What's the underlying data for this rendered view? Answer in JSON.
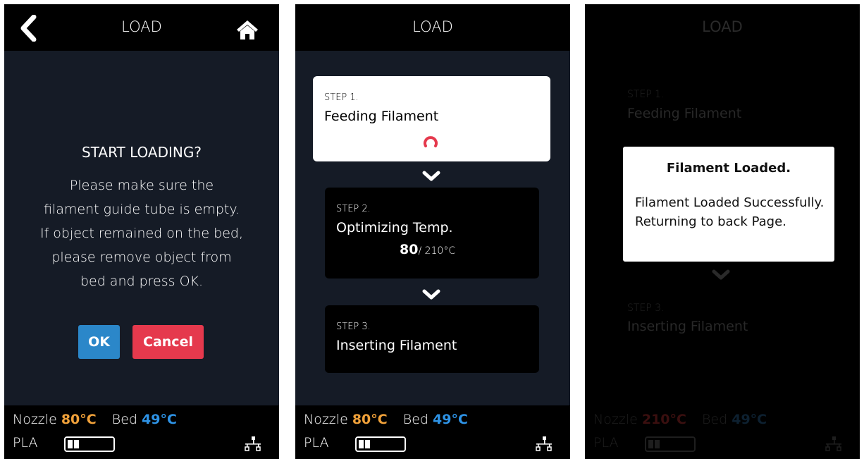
{
  "screens": [
    {
      "title": "LOAD",
      "prompt_title": "START LOADING?",
      "prompt_lines": [
        "Please make sure the",
        "filament guide tube is empty.",
        "If object remained on the bed,",
        "please remove object from",
        "bed and press OK."
      ],
      "ok_label": "OK",
      "cancel_label": "Cancel"
    },
    {
      "title": "LOAD",
      "steps": [
        {
          "kicker": "STEP 1.",
          "name": "Feeding Filament"
        },
        {
          "kicker": "STEP 2.",
          "name": "Optimizing Temp.",
          "current": "80",
          "target": "/ 210°C"
        },
        {
          "kicker": "STEP 3.",
          "name": "Inserting Filament"
        }
      ]
    },
    {
      "title": "LOAD",
      "steps": [
        {
          "kicker": "STEP 1.",
          "name": "Feeding Filament"
        },
        {
          "kicker": "STEP 3.",
          "name": "Inserting Filament"
        }
      ],
      "modal_title": "Filament Loaded.",
      "modal_body": "Filament Loaded Successfully. Returning to back Page."
    }
  ],
  "status": [
    {
      "nozzle_label": "Nozzle",
      "nozzle_temp": "80°C",
      "bed_label": "Bed",
      "bed_temp": "49°C",
      "material": "PLA"
    },
    {
      "nozzle_label": "Nozzle",
      "nozzle_temp": "80°C",
      "bed_label": "Bed",
      "bed_temp": "49°C",
      "material": "PLA"
    },
    {
      "nozzle_label": "Nozzle",
      "nozzle_temp": "210°C",
      "bed_label": "Bed",
      "bed_temp": "49°C",
      "material": "PLA"
    }
  ],
  "colors": {
    "nozzle": "#f0a13a",
    "bed": "#2e93e6",
    "ok": "#2b87c9",
    "cancel": "#e5394d",
    "spinner": "#e5394d"
  },
  "icons": {
    "back": "chevron-left-icon",
    "home": "home-icon",
    "network": "network-icon",
    "chevron": "chevron-down-icon",
    "spinner": "loading-spinner-icon"
  }
}
